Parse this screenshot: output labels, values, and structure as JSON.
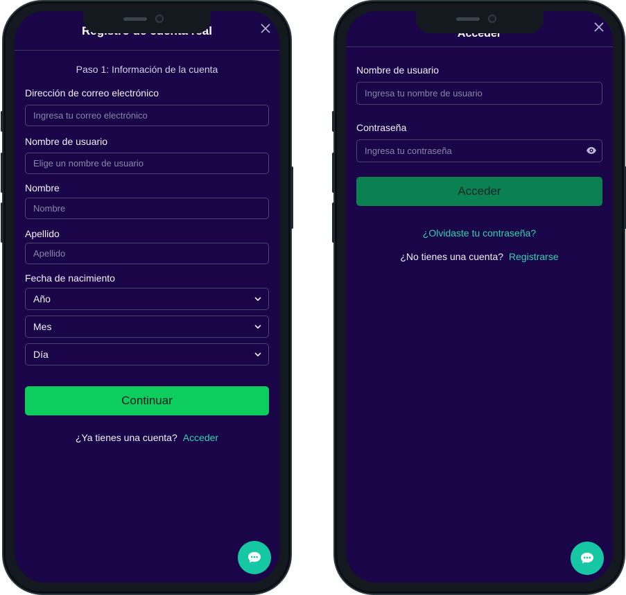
{
  "register": {
    "title": "Registro de cuenta real",
    "step": "Paso 1: Información de la cuenta",
    "email_label": "Dirección de correo electrónico",
    "email_placeholder": "Ingresa tu correo electrónico",
    "username_label": "Nombre de usuario",
    "username_placeholder": "Elige un nombre de usuario",
    "firstname_label": "Nombre",
    "firstname_placeholder": "Nombre",
    "lastname_label": "Apellido",
    "lastname_placeholder": "Apellido",
    "birthdate_label": "Fecha de nacimiento",
    "year_select": "Año",
    "month_select": "Mes",
    "day_select": "Día",
    "continue_label": "Continuar",
    "footer_text": "¿Ya tienes una cuenta?",
    "footer_link": "Acceder"
  },
  "login": {
    "title": "Acceder",
    "username_label": "Nombre de usuario",
    "username_placeholder": "Ingresa tu nombre de usuario",
    "password_label": "Contraseña",
    "password_placeholder": "Ingresa tu contraseña",
    "submit_label": "Acceder",
    "forgot_link": "¿Olvidaste tu contraseña?",
    "footer_text": "¿No tienes una cuenta?",
    "footer_link": "Registrarse"
  },
  "icons": {
    "close": "close-icon",
    "chevron": "chevron-down-icon",
    "eye": "eye-icon",
    "chat": "chat-icon"
  },
  "colors": {
    "screen_bg": "#1a0548",
    "register_button": "#0ccd5e",
    "login_button": "#0b8152",
    "link": "#33d3b0",
    "chat_button": "#16c7a4"
  }
}
